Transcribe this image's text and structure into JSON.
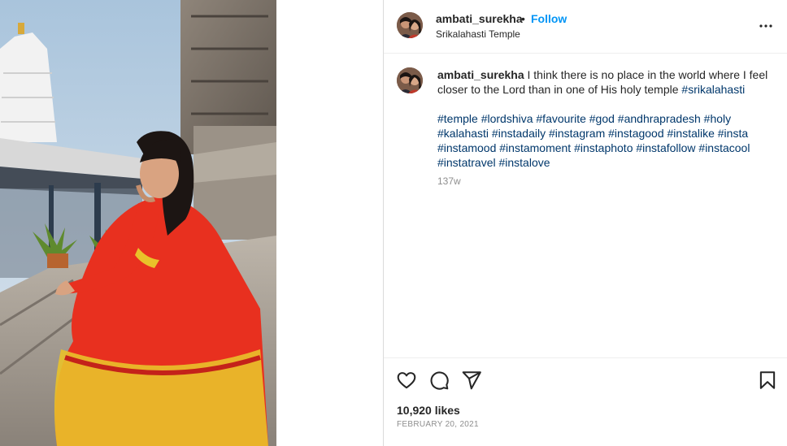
{
  "post": {
    "image_alt": "Woman in red dress sitting on temple steps",
    "author": {
      "username": "ambati_surekha",
      "separator": "•",
      "follow_label": "Follow",
      "location": "Srikalahasti Temple"
    },
    "more_icon": "more-horizontal-icon",
    "caption": {
      "username": "ambati_surekha",
      "text": " I think there is no place in the world where I feel closer to the Lord than in one of His holy temple ",
      "inline_tag": "#srikalahasti",
      "hashtags": "#temple #lordshiva #favourite #god #andhrapradesh #holy #kalahasti #instadaily #instagram #instagood #instalike #insta #instamood #instamoment #instaphoto #instafollow #instacool #instatravel #instalove",
      "age": "137w"
    },
    "actions": {
      "like_icon": "heart-icon",
      "comment_icon": "comment-icon",
      "share_icon": "send-icon",
      "save_icon": "bookmark-icon"
    },
    "likes": "10,920 likes",
    "date": "FEBRUARY 20, 2021"
  },
  "colors": {
    "link": "#0095f6",
    "hashtag": "#00376b",
    "muted": "#8e8e8e",
    "dress": "#e8301f",
    "dress_trim": "#e9c22a"
  }
}
